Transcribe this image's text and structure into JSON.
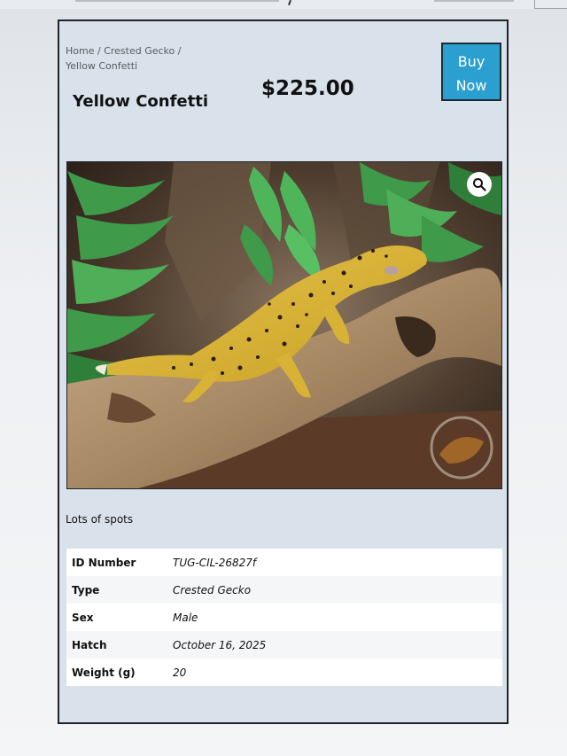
{
  "breadcrumb": {
    "home": "Home",
    "sep1": " / ",
    "category": "Crested Gecko",
    "sep2": " /",
    "current": "Yellow Confetti"
  },
  "product": {
    "title": "Yellow Confetti",
    "price": "$225.00",
    "buy_label": "Buy Now",
    "description": "Lots of spots"
  },
  "image": {
    "zoom_icon": "search-icon",
    "watermark_icon": "the-urban-reptile-logo"
  },
  "specs": [
    {
      "label": "ID Number",
      "value": "TUG-CIL-26827f"
    },
    {
      "label": "Type",
      "value": "Crested Gecko"
    },
    {
      "label": "Sex",
      "value": "Male"
    },
    {
      "label": "Hatch",
      "value": "October 16, 2025"
    },
    {
      "label": "Weight (g)",
      "value": "20"
    }
  ],
  "colors": {
    "card_bg": "#d9e2ea",
    "button_bg": "#2a9fd0",
    "text": "#111111"
  }
}
